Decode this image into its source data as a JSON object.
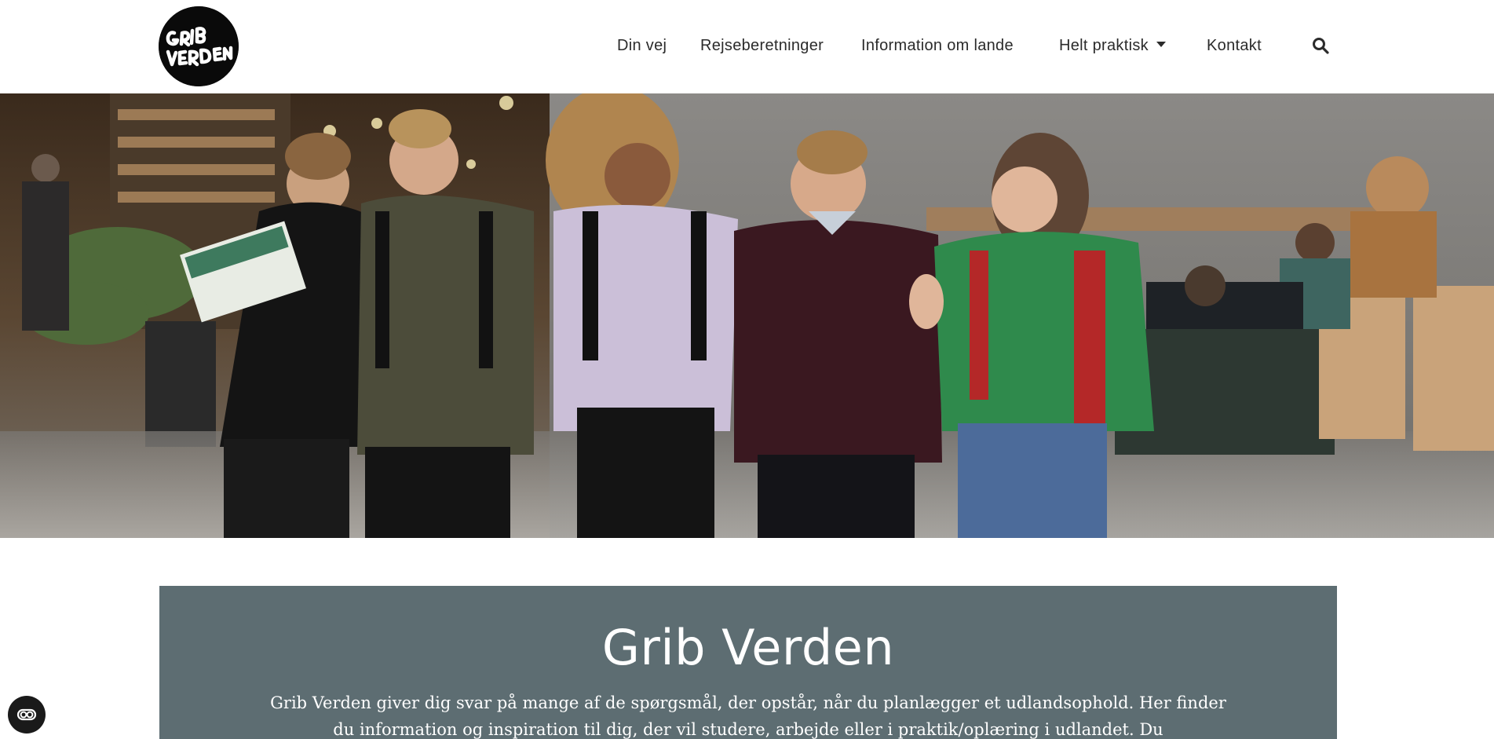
{
  "header": {
    "logo_text_top": "GRIB",
    "logo_text_bottom": "VERDEN",
    "nav": [
      {
        "label": "Din vej"
      },
      {
        "label": "Rejseberetninger"
      },
      {
        "label": "Information om lande"
      },
      {
        "label": "Helt praktisk",
        "has_dropdown": true
      },
      {
        "label": "Kontakt"
      }
    ],
    "search_icon": "search-icon"
  },
  "hero": {
    "image_icon": "hero-photo"
  },
  "intro": {
    "title": "Grib Verden",
    "text": "Grib Verden giver dig svar på mange af de spørgsmål, der opstår, når du planlægger et udlandsophold. Her finder du information og inspiration til dig, der vil studere, arbejde eller i praktik/oplæring i udlandet. Du"
  },
  "accessibility": {
    "icon": "accessibility-toggle-icon"
  },
  "colors": {
    "intro_bg": "#5d6d72",
    "nav_text": "#2b2b2b",
    "logo_bg": "#0a0a0a"
  }
}
